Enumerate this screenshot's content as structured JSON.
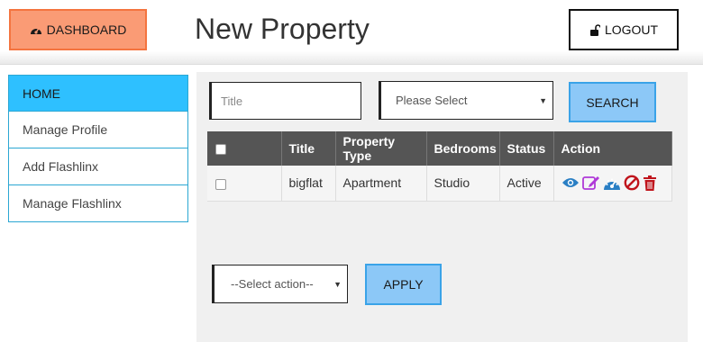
{
  "header": {
    "dashboard_label": "DASHBOARD",
    "page_title": "New Property",
    "logout_label": "LOGOUT"
  },
  "sidebar": {
    "items": [
      {
        "label": "HOME",
        "active": true
      },
      {
        "label": "Manage Profile"
      },
      {
        "label": "Add Flashlinx"
      },
      {
        "label": "Manage Flashlinx"
      }
    ]
  },
  "filters": {
    "title_placeholder": "Title",
    "select_value": "Please Select",
    "search_label": "SEARCH"
  },
  "table": {
    "columns": [
      "Title",
      "Property Type",
      "Bedrooms",
      "Status",
      "Action"
    ],
    "rows": [
      {
        "title": "bigflat",
        "property_type": "Apartment",
        "bedrooms": "Studio",
        "status": "Active"
      }
    ],
    "action_icons": [
      "eye-icon",
      "edit-icon",
      "dashboard-icon",
      "ban-icon",
      "trash-icon"
    ]
  },
  "bulk": {
    "select_value": "--Select action--",
    "apply_label": "APPLY"
  },
  "colors": {
    "dashboard_bg": "#fa9b75",
    "sidebar_active": "#2ec0ff",
    "button_blue": "#8cc8f7",
    "table_header": "#555555",
    "icon_blue": "#2a7fc4",
    "icon_purple": "#b03ad8",
    "icon_red": "#c0141c"
  }
}
